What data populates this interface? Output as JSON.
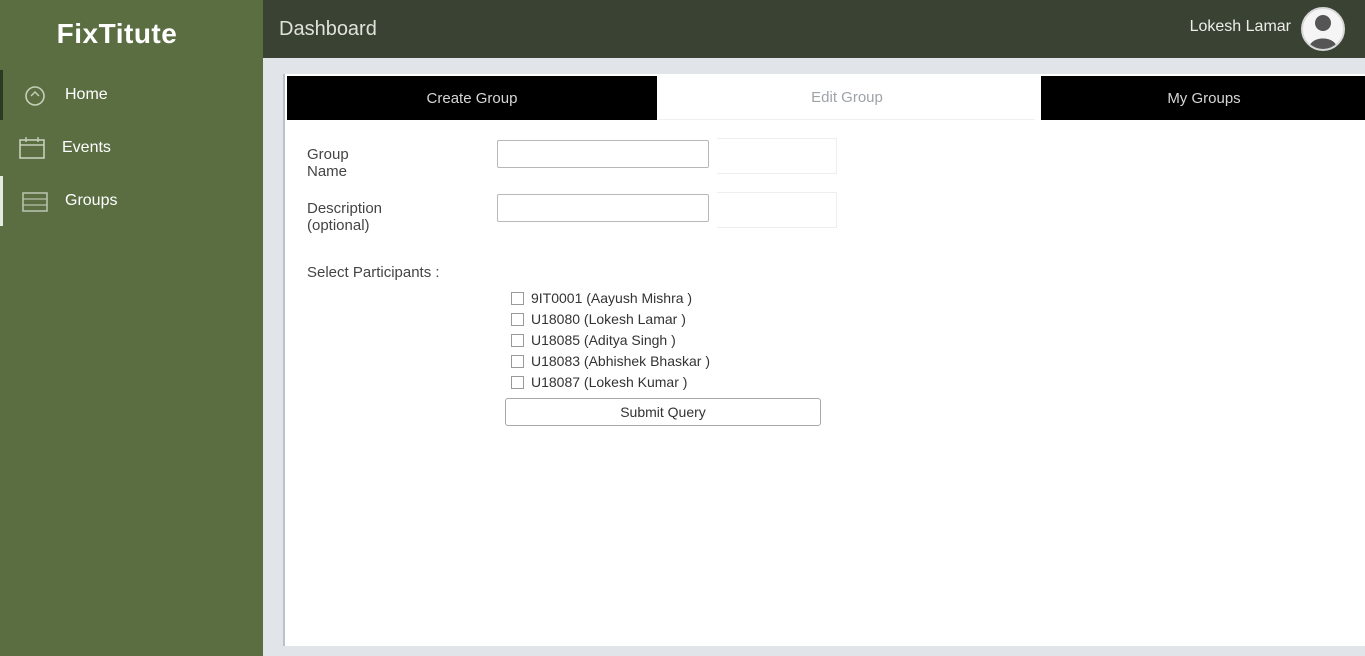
{
  "brand": "FixTitute",
  "sidebar": {
    "items": [
      {
        "label": "Home",
        "icon": "home-icon"
      },
      {
        "label": "Events",
        "icon": "calendar-icon"
      },
      {
        "label": "Groups",
        "icon": "groups-icon"
      }
    ]
  },
  "topbar": {
    "title": "Dashboard",
    "user_name": "Lokesh Lamar"
  },
  "tabs": [
    {
      "label": "Create Group",
      "style": "dark"
    },
    {
      "label": "Edit Group",
      "style": "light"
    },
    {
      "label": "My Groups",
      "style": "dark"
    }
  ],
  "form": {
    "group_name_label": "Group Name",
    "group_name_value": "",
    "description_label": "Description (optional)",
    "description_value": "",
    "participants_label": "Select Participants :",
    "participants": [
      "9IT0001 (Aayush Mishra )",
      "U18080 (Lokesh Lamar )",
      "U18085 (Aditya Singh )",
      "U18083 (Abhishek Bhaskar )",
      "U18087 (Lokesh Kumar )"
    ],
    "submit_label": "Submit Query"
  },
  "colors": {
    "sidebar": "#5a6e42",
    "topbar": "#3a4233",
    "tab_dark": "#000000",
    "content_bg": "#e1e5ea"
  }
}
